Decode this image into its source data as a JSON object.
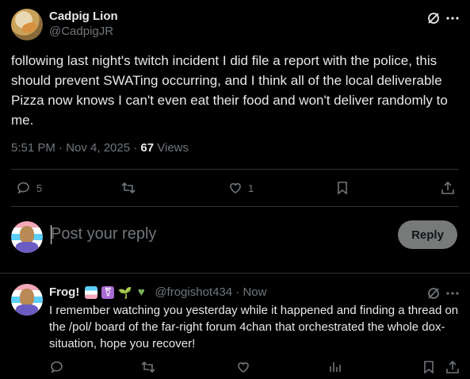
{
  "post": {
    "author_name": "Cadpig Lion",
    "author_handle": "@CadpigJR",
    "text": "following last night's twitch incident I did file a report with the police, this should prevent SWATing occurring, and I think all of the local deliverable Pizza now knows I can't even eat their food and won't deliver randomly to me.",
    "time": "5:51 PM · Nov 4, 2025 · ",
    "views_count": "67",
    "views_label": " Views",
    "replies": "5",
    "likes": "1"
  },
  "composer": {
    "placeholder": "Post your reply",
    "reply_label": "Reply"
  },
  "reply": {
    "author_name": "Frog!",
    "emoji_names": [
      "transgender-flag",
      "transgender-symbol",
      "seedling",
      "green-heart"
    ],
    "handle_time": "@frogishot434 · Now",
    "text": "I remember watching you yesterday while it happened and finding a thread on the /pol/ board of the far-right forum 4chan that orchestrated the whole dox-situation, hope you recover!"
  },
  "colors": {
    "background": "#000000",
    "text": "#e7e9ea",
    "secondary": "#71767b",
    "divider": "#2f3336"
  }
}
